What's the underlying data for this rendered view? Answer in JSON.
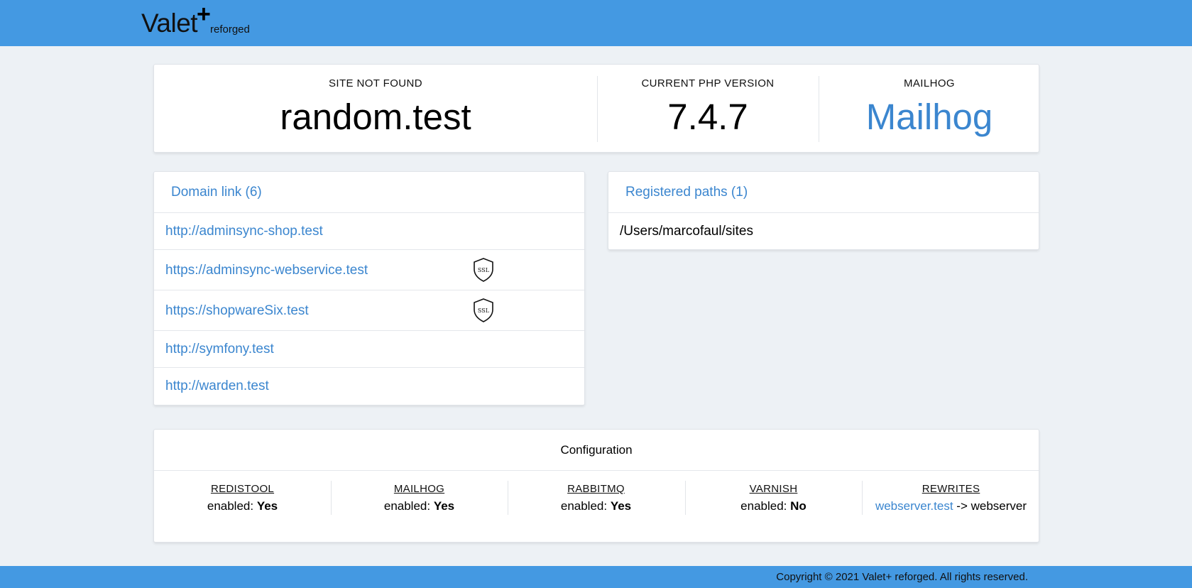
{
  "header": {
    "logo_main": "Valet",
    "logo_plus": "+",
    "logo_sub": "reforged"
  },
  "status": {
    "site_label": "SITE NOT FOUND",
    "site_value": "random.test",
    "php_label": "CURRENT PHP VERSION",
    "php_value": "7.4.7",
    "mailhog_label": "MAILHOG",
    "mailhog_value": "Mailhog"
  },
  "domains": {
    "title": "Domain link (6)",
    "items": [
      {
        "url": "http://adminsync-shop.test",
        "ssl": false
      },
      {
        "url": "https://adminsync-webservice.test",
        "ssl": true
      },
      {
        "url": "https://shopwareSix.test",
        "ssl": true
      },
      {
        "url": "http://symfony.test",
        "ssl": false
      },
      {
        "url": "http://warden.test",
        "ssl": false
      }
    ],
    "ssl_badge": "SSL"
  },
  "paths": {
    "title": "Registered paths (1)",
    "items": [
      "/Users/marcofaul/sites"
    ]
  },
  "configuration": {
    "title": "Configuration",
    "enabled_prefix": "enabled:",
    "items": [
      {
        "title": "REDISTOOL",
        "value": "Yes"
      },
      {
        "title": "MAILHOG",
        "value": "Yes"
      },
      {
        "title": "RABBITMQ",
        "value": "Yes"
      },
      {
        "title": "VARNISH",
        "value": "No"
      }
    ],
    "rewrites": {
      "title": "REWRITES",
      "link": "webserver.test",
      "arrow": "->",
      "target": "webserver"
    }
  },
  "footer": {
    "copyright": "Copyright © 2021 Valet+ reforged. All rights reserved."
  },
  "colors": {
    "header_bg": "#4499e2",
    "link": "#3b86cf",
    "page_bg": "#edf1f5"
  }
}
